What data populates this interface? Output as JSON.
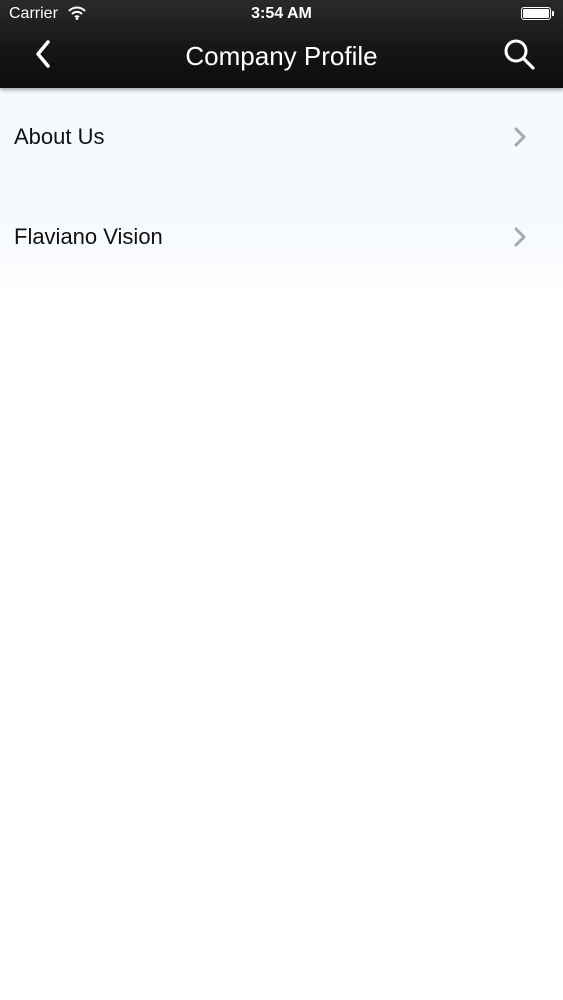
{
  "status_bar": {
    "carrier": "Carrier",
    "time": "3:54 AM",
    "wifi_icon": "wifi-icon",
    "battery_icon": "battery-icon"
  },
  "nav_bar": {
    "title": "Company Profile",
    "back_icon": "chevron-left-icon",
    "search_icon": "search-icon"
  },
  "menu": {
    "items": [
      {
        "label": "About Us",
        "icon": "chevron-right-icon"
      },
      {
        "label": "Flaviano Vision",
        "icon": "chevron-right-icon"
      }
    ]
  },
  "colors": {
    "nav_bar_background": "#161616",
    "nav_bar_text": "#ffffff",
    "list_background": "#f5f9fd",
    "list_text": "#111111",
    "chevron": "#a8a8a8",
    "page_background": "#ffffff"
  }
}
